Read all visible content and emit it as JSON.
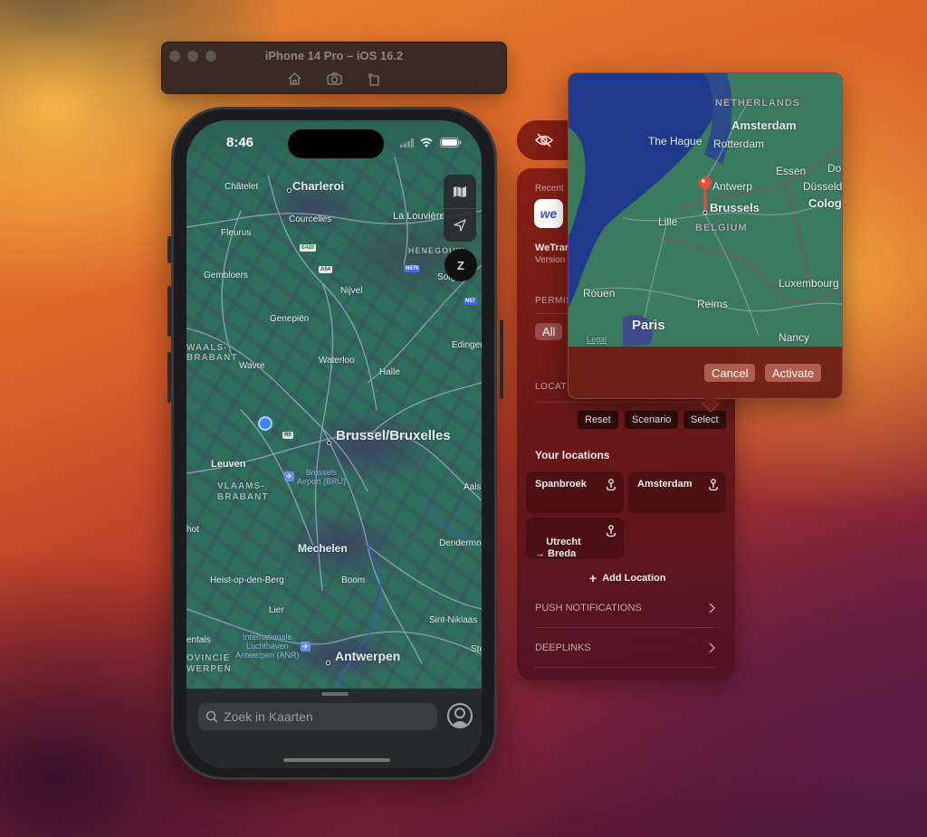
{
  "simulator": {
    "title": "iPhone 14 Pro – iOS 16.2",
    "toolbar_icons": [
      "home-icon",
      "screenshot-icon",
      "rotate-icon"
    ]
  },
  "phone": {
    "status": {
      "time": "8:46",
      "icons": [
        "cellular-signal-icon",
        "wifi-icon",
        "battery-icon"
      ]
    },
    "map_labels": {
      "charleroi": "Charleroi",
      "chatelet": "Châtelet",
      "courcelles": "Courcelles",
      "la_louviere": "La Louvière",
      "fleurus": "Fleurus",
      "gembloers": "Gembloers",
      "nijvel": "Nijvel",
      "genepien": "Genepiën",
      "waals_brabant": "WAALS-\nBRABANT",
      "wavre": "Wavre",
      "waterloo": "Waterloo",
      "halle": "Halle",
      "edingen": "Edingen",
      "brussel": "Brussel/Bruxelles",
      "leuven": "Leuven",
      "vlaams_brabant": "VLAAMS-\nBRABANT",
      "airport_bru": "Brussels\nAirport (BRU)",
      "aalst": "Aalst",
      "hot": "hot",
      "mechelen": "Mechelen",
      "dendermonde": "Dendermond",
      "heist": "Heist-op-den-Berg",
      "boom": "Boom",
      "lier": "Lier",
      "sint_niklaas": "Sint-Niklaas",
      "entals": "entals",
      "airport_anr": "Internationale\nLuchthaven\nAntwerpen (ANR)",
      "antwerpen": "Antwerpen",
      "provincie": "OVINCIE\nWERPEN",
      "ste": "Ste",
      "soig": "Soig",
      "hen": "HENEGOUW"
    },
    "road_shields": {
      "e420": "E420",
      "a54": "A54",
      "n576": "N576",
      "n57": "N57",
      "r0": "R0"
    },
    "map_controls": {
      "map_mode": "map-icon",
      "location": "location-arrow-icon",
      "compass": "Z"
    },
    "search": {
      "placeholder": "Zoek in Kaarten"
    }
  },
  "panel": {
    "recent_label": "Recent",
    "app_name": "WeTran",
    "app_version": "Version",
    "app_logo_text": "we",
    "permissions_header": "PERMIS",
    "permissions_filter": "All",
    "location_header": "LOCATI",
    "location_buttons": [
      "Reset",
      "Scenario",
      "Select"
    ],
    "your_locations_title": "Your locations",
    "locations": [
      {
        "name": "Spanbroek"
      },
      {
        "name": "Amsterdam"
      },
      {
        "name": "Utrecht\n→ Breda"
      }
    ],
    "add_location": "Add Location",
    "rows": [
      {
        "label": "PUSH NOTIFICATIONS"
      },
      {
        "label": "DEEPLINKS"
      }
    ]
  },
  "popover": {
    "map_labels": {
      "netherlands": "NETHERLANDS",
      "amsterdam": "Amsterdam",
      "the_hague": "The Hague",
      "rotterdam": "Rotterdam",
      "essen": "Essen",
      "dortmund": "Dor",
      "dusseldorf": "Düsseldo",
      "cologne": "Cologn",
      "antwerp": "Antwerp",
      "brussels": "Brussels",
      "belgium": "BELGIUM",
      "lille": "Lille",
      "luxembourg": "Luxembourg",
      "rouen": "Rouen",
      "reims": "Reims",
      "paris": "Paris",
      "nancy": "Nancy",
      "legal": "Legal"
    },
    "cancel": "Cancel",
    "activate": "Activate"
  }
}
